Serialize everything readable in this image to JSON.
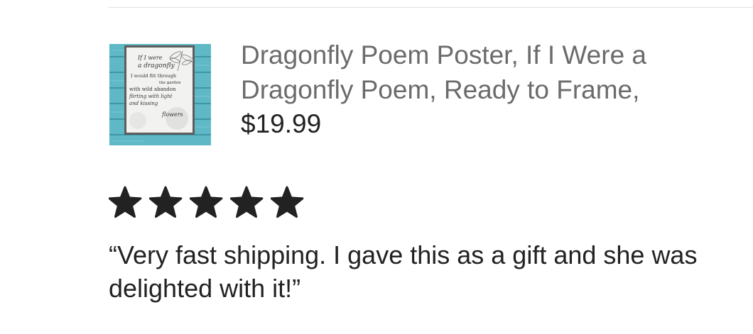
{
  "listing": {
    "title": "Dragonfly Poem Poster, If I Were a Dragonfly Poem, Ready to Frame,",
    "price": "$19.99",
    "image": {
      "poem_lines": [
        "If I were",
        "a dragonfly",
        "I would flit through",
        "the garden",
        "with wild abandon",
        "flirting with light",
        "and kissing",
        "flowers"
      ],
      "colors": {
        "wood": "#5fb8c6",
        "wood_dark": "#3f97a6",
        "paper": "#f2f2f0",
        "frame": "#5d5d5d",
        "ink": "#333333"
      }
    }
  },
  "review": {
    "rating": 5,
    "rating_max": 5,
    "star_color": "#222222",
    "text": "“Very fast shipping.  I gave this as a gift and she was delighted with it!”"
  },
  "colors": {
    "title": "#6b6b6b",
    "text": "#222222",
    "divider": "#e1e1e1"
  }
}
